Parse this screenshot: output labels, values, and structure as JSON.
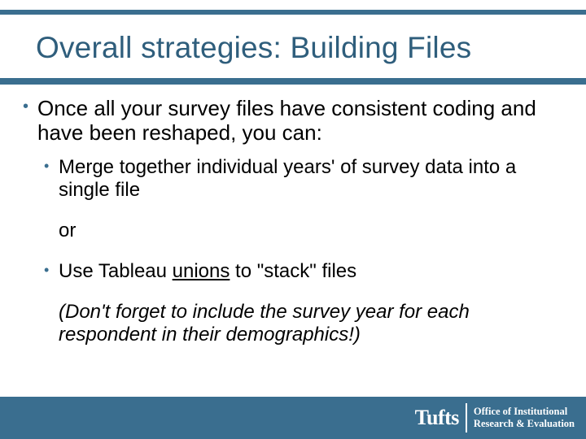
{
  "title": "Overall strategies: Building Files",
  "bullets": {
    "main": "Once all your survey files have consistent coding and have been reshaped, you can:",
    "sub1": "Merge together individual years' of survey data into a single file",
    "or": "or",
    "sub2_pre": "Use Tableau ",
    "sub2_underlined": "unions",
    "sub2_post": " to \"stack\" files",
    "note": "(Don't forget to include the survey year for each respondent in their demographics!)"
  },
  "footer": {
    "logo": "Tufts",
    "office_line1": "Office of Institutional",
    "office_line2": "Research & Evaluation"
  }
}
